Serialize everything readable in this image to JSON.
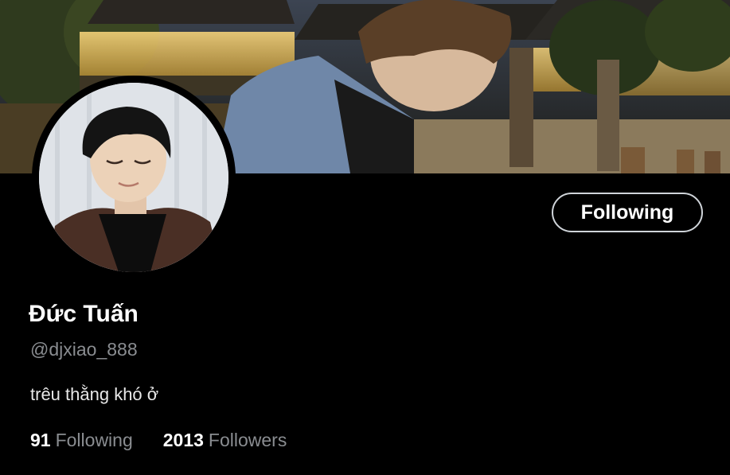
{
  "profile": {
    "display_name": "Đức Tuấn",
    "handle": "@djxiao_888",
    "bio": "trêu thằng khó ở",
    "follow_button_label": "Following"
  },
  "stats": {
    "following_count": "91",
    "following_label": "Following",
    "followers_count": "2013",
    "followers_label": "Followers"
  },
  "colors": {
    "background": "#000000",
    "text_primary": "#ffffff",
    "text_secondary": "#8a8d91",
    "button_border": "#cfd4d9"
  }
}
